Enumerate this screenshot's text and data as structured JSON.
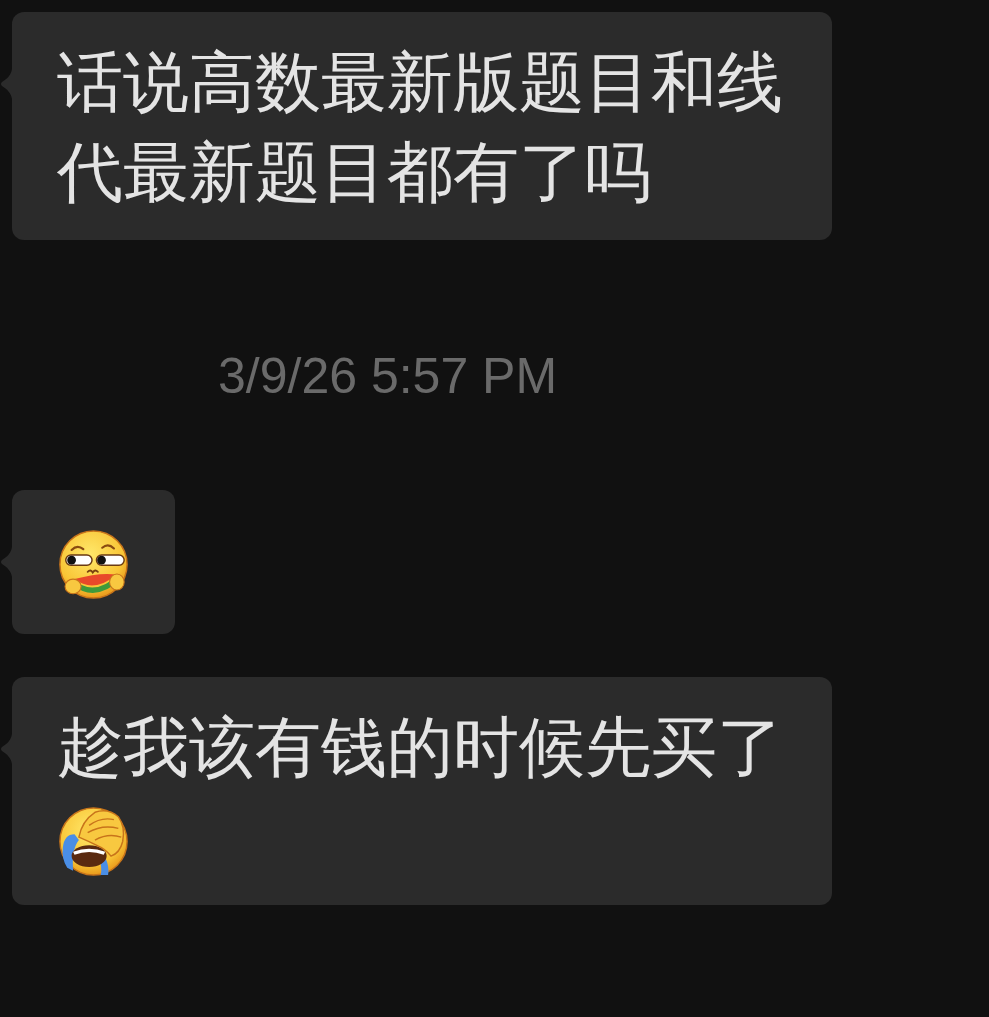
{
  "messages": [
    {
      "kind": "bubble",
      "parts": [
        {
          "kind": "text",
          "text": "话说高数最新版题目和线代最新题目都有了吗"
        }
      ]
    },
    {
      "kind": "time",
      "text": "3/9/26 5:57 PM"
    },
    {
      "kind": "bubble",
      "parts": [
        {
          "kind": "melon"
        }
      ]
    },
    {
      "kind": "bubble",
      "parts": [
        {
          "kind": "text",
          "text": "趁我该有钱的时候先买了"
        },
        {
          "kind": "facepalm"
        }
      ]
    }
  ]
}
